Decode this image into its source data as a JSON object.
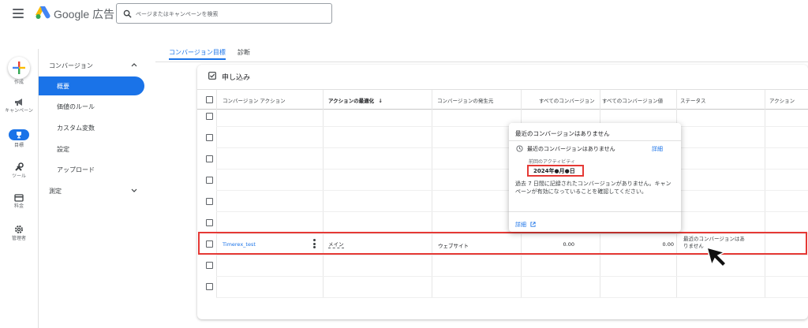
{
  "header": {
    "product_name": "Google 広告",
    "search": {
      "placeholder": "ページまたはキャンペーンを検索"
    }
  },
  "rail": {
    "create_label": "作成",
    "items": [
      {
        "label": "キャンペーン",
        "icon": "megaphone-icon"
      },
      {
        "label": "目標",
        "icon": "trophy-icon",
        "active": true
      },
      {
        "label": "ツール",
        "icon": "tools-icon"
      },
      {
        "label": "料金",
        "icon": "billing-icon"
      },
      {
        "label": "管理者",
        "icon": "gear-icon"
      }
    ]
  },
  "nav": {
    "section_title": "コンバージョン",
    "items": [
      {
        "label": "概要",
        "active": true
      },
      {
        "label": "価値のルール"
      },
      {
        "label": "カスタム変数"
      },
      {
        "label": "設定"
      },
      {
        "label": "アップロード"
      }
    ],
    "measure_label": "測定"
  },
  "tabs": [
    {
      "label": "コンバージョン目標",
      "active": true
    },
    {
      "label": "診断"
    }
  ],
  "card": {
    "apply_label": "申し込み",
    "columns": [
      "コンバージョン アクション",
      "アクションの最適化",
      "コンバージョンの発生元",
      "すべてのコンバージョン",
      "すべてのコンバージョン値",
      "ステータス",
      "アクション"
    ],
    "sort_indicator": "↓",
    "row": {
      "name": "Timerex_test",
      "optimization": "メイン",
      "source": "ウェブサイト",
      "all_conversions": "0.00",
      "all_conversion_value": "0.00",
      "status": "最近のコンバージョンはありません"
    }
  },
  "popover": {
    "title": "最近のコンバージョンはありません",
    "status": "最近のコンバージョンはありません",
    "detail_link": "詳細",
    "previous_activity_label": "前回のアクティビティ",
    "date": "2024年●月●日",
    "body": "過去 7 日間に記録されたコンバージョンがありません。キャンペーンが有効になっていることを確認してください。",
    "footer_link": "詳細"
  },
  "colors": {
    "accent": "#1a73e8",
    "highlight": "#e53935"
  }
}
